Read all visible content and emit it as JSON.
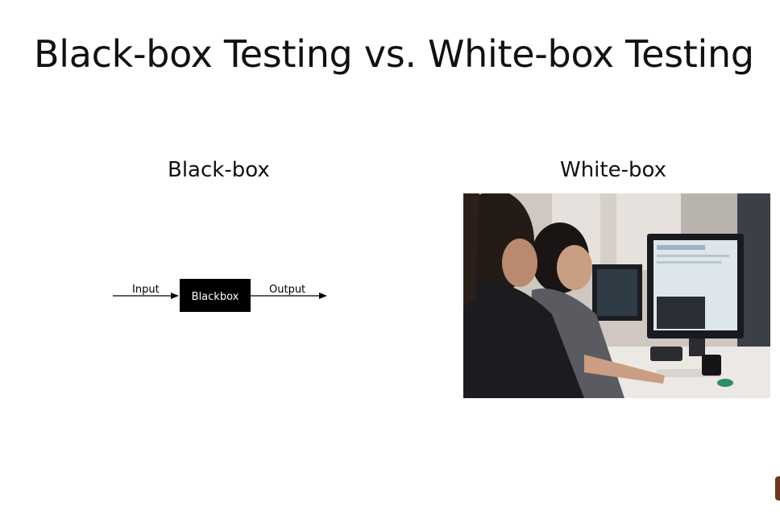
{
  "slide": {
    "title": "Black-box Testing vs. White-box Testing",
    "left_heading": "Black-box",
    "right_heading": "White-box"
  },
  "diagram": {
    "input_label": "Input",
    "box_label": "Blackbox",
    "output_label": "Output"
  },
  "photo": {
    "subject": "two people working at computer monitors in an office"
  }
}
